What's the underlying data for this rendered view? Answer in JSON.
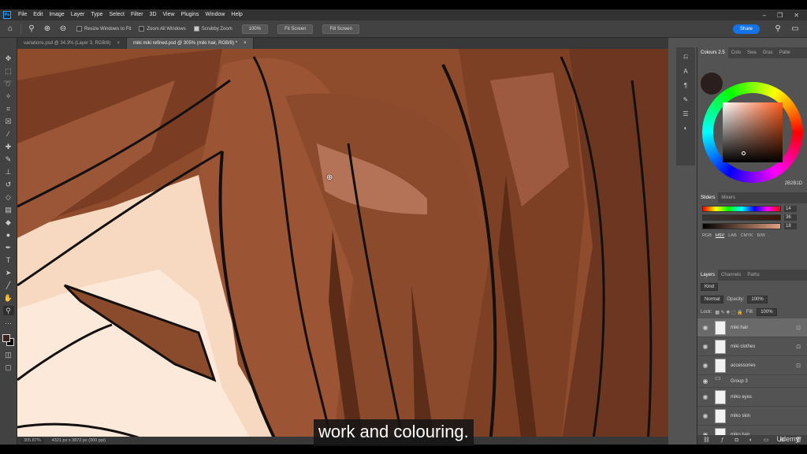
{
  "menu": {
    "logo": "Ps",
    "items": [
      "File",
      "Edit",
      "Image",
      "Layer",
      "Type",
      "Select",
      "Filter",
      "3D",
      "View",
      "Plugins",
      "Window",
      "Help"
    ],
    "window_controls": [
      "–",
      "❐",
      "✕"
    ]
  },
  "options": {
    "resize_windows": "Resize Windows to Fit",
    "zoom_all": "Zoom All Windows",
    "scrubby_zoom": "Scrubby Zoom",
    "zoom_value": "100%",
    "fit_screen": "Fit Screen",
    "fill_screen": "Fill Screen",
    "share": "Share"
  },
  "tabs": [
    {
      "label": "variations.psd @ 34.3% (Layer 3, RGB/8)",
      "close": "×"
    },
    {
      "label": "miki miki refined.psd @ 305% (miki hair, RGB/8) *",
      "close": "×"
    }
  ],
  "status": {
    "zoom": "305.87%",
    "dimensions": "4321 px x 3872 px (300 ppi)"
  },
  "subtitle": "work and colouring.",
  "color_panel": {
    "tabs": [
      "Colours 2.5",
      "Colo",
      "Swa",
      "Grac",
      "Patte"
    ],
    "hex": "2B2B1D",
    "fg_color": "#2b1f1e"
  },
  "sliders": {
    "tabs": [
      "Sliders",
      "Mixers"
    ],
    "values": [
      "14",
      "36",
      "18"
    ],
    "modes": [
      "RGB",
      "HSV",
      "LAB",
      "CMYK",
      "B/W"
    ],
    "active_mode": "HSV"
  },
  "layers": {
    "tabs": [
      "Layers",
      "Channels",
      "Paths"
    ],
    "kind": "Kind",
    "blend": "Normal",
    "opacity_label": "Opacity:",
    "opacity": "100%",
    "lock_label": "Lock:",
    "fill_label": "Fill:",
    "fill": "100%",
    "items": [
      {
        "name": "miki hair",
        "active": true
      },
      {
        "name": "miki clothes",
        "active": false
      },
      {
        "name": "accessories",
        "active": false
      },
      {
        "name": "Group 3",
        "folder": true
      },
      {
        "name": "miko eyes",
        "active": false
      },
      {
        "name": "miko skin",
        "active": false
      },
      {
        "name": "miko hair",
        "active": false
      }
    ]
  },
  "watermark": "Udemy"
}
